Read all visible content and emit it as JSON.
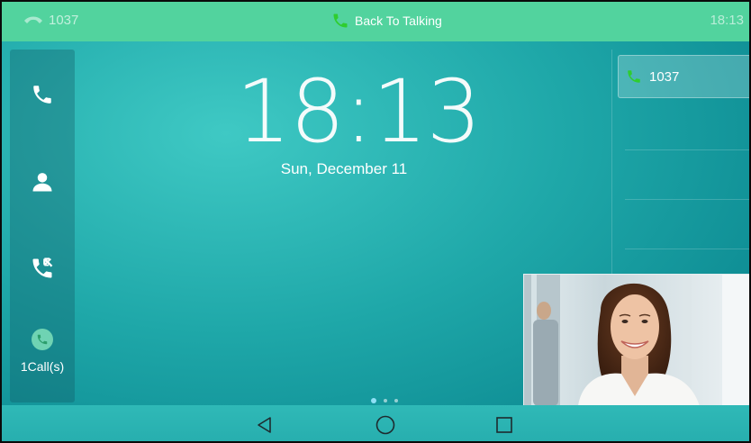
{
  "status_bar": {
    "line_label": "1037",
    "back_to_talking": "Back To Talking",
    "time": "18:13"
  },
  "sidebar": {
    "items": [
      {
        "icon": "phone-icon"
      },
      {
        "icon": "contact-icon"
      },
      {
        "icon": "call-history-icon"
      }
    ],
    "calls_label": "1Call(s)"
  },
  "clock": {
    "time": "18:13",
    "date": "Sun, December 11"
  },
  "lines": {
    "account": "1037"
  },
  "page_indicator": {
    "count": 3,
    "active": 1
  },
  "colors": {
    "status_bar": "#52d39e",
    "phone_green": "#3ed13e",
    "background": "#1fa8a9"
  }
}
